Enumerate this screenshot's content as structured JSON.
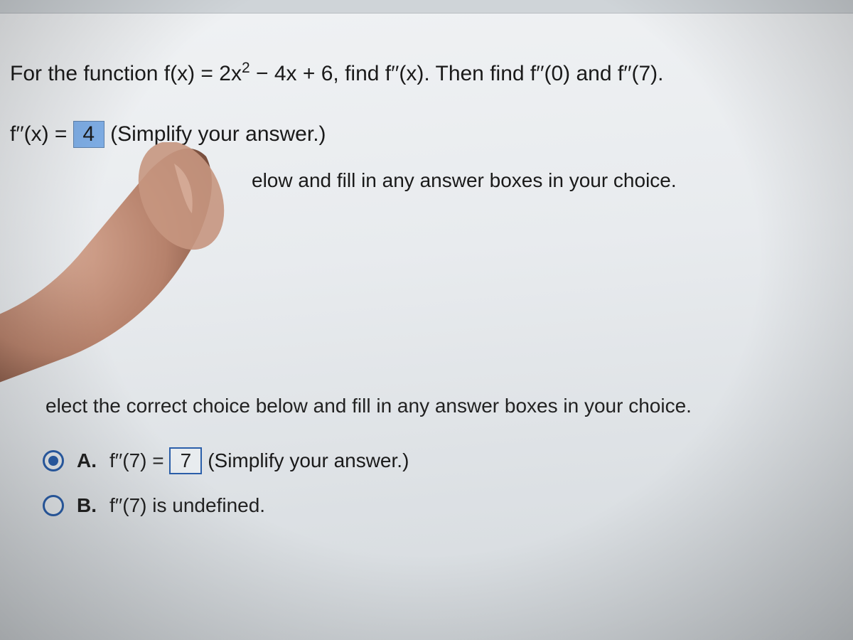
{
  "question": {
    "prefix": "For the function f(x) = 2x",
    "exponent": "2",
    "middle": " − 4x + 6, find f′′(x). Then find f′′(0) and f′′(7)."
  },
  "answer1": {
    "lhs": "f′′(x) = ",
    "value": "4",
    "hint": "  (Simplify your answer.)"
  },
  "instruction_fragment": "elow and fill in any answer boxes in your choice.",
  "instruction2": "elect the correct choice below and fill in any answer boxes in your choice.",
  "choices": {
    "a": {
      "label": "A.",
      "lhs": "f′′(7) = ",
      "value": "7",
      "hint": " (Simplify your answer.)"
    },
    "b": {
      "label": "B.",
      "text": "f′′(7) is undefined."
    }
  }
}
